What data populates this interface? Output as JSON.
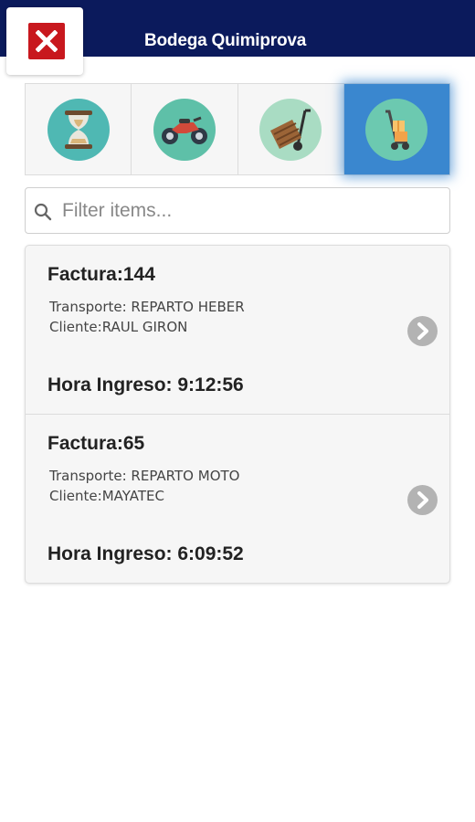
{
  "header": {
    "title": "Bodega Quimiprova"
  },
  "close_icon": "close-icon",
  "colors": {
    "header_bg": "#0b1a5c",
    "active_tab": "#3a87cf",
    "close_red": "#c8181e"
  },
  "tabs": [
    {
      "icon": "hourglass-icon",
      "active": false
    },
    {
      "icon": "motorcycle-icon",
      "active": false
    },
    {
      "icon": "hand-truck-crate-icon",
      "active": false
    },
    {
      "icon": "dolly-boxes-icon",
      "active": true
    }
  ],
  "search": {
    "placeholder": "Filter items..."
  },
  "items": [
    {
      "title": "Factura:144",
      "transporte": "Transporte: REPARTO HEBER",
      "cliente": "Cliente:RAUL GIRON",
      "hora": "Hora Ingreso: 9:12:56"
    },
    {
      "title": "Factura:65",
      "transporte": "Transporte: REPARTO MOTO",
      "cliente": "Cliente:MAYATEC",
      "hora": "Hora Ingreso: 6:09:52"
    }
  ]
}
